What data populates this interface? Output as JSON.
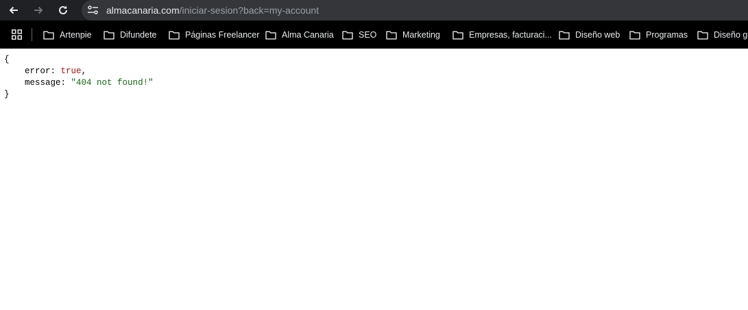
{
  "browser": {
    "url_host": "almacanaria.com",
    "url_path": "/iniciar-sesion?back=my-account",
    "icons": {
      "back": "arrow-left-icon",
      "forward": "arrow-right-icon",
      "reload": "reload-icon",
      "site_info": "tune-icon",
      "apps": "apps-grid-icon",
      "folder": "folder-icon"
    }
  },
  "bookmarks": [
    {
      "label": "Artenpie"
    },
    {
      "label": "Difundete"
    },
    {
      "label": "Páginas Freelancer"
    },
    {
      "label": "Alma Canaria"
    },
    {
      "label": "SEO"
    },
    {
      "label": "Marketing"
    },
    {
      "label": "Empresas, facturaci..."
    },
    {
      "label": "Diseño web"
    },
    {
      "label": "Programas"
    },
    {
      "label": "Diseño g"
    }
  ],
  "json_view": {
    "open_brace": "{",
    "close_brace": "}",
    "lines": [
      {
        "key": "error",
        "value": "true",
        "suffix": ","
      },
      {
        "key": "message",
        "value": "\"404 not found!\"",
        "suffix": ""
      }
    ]
  }
}
